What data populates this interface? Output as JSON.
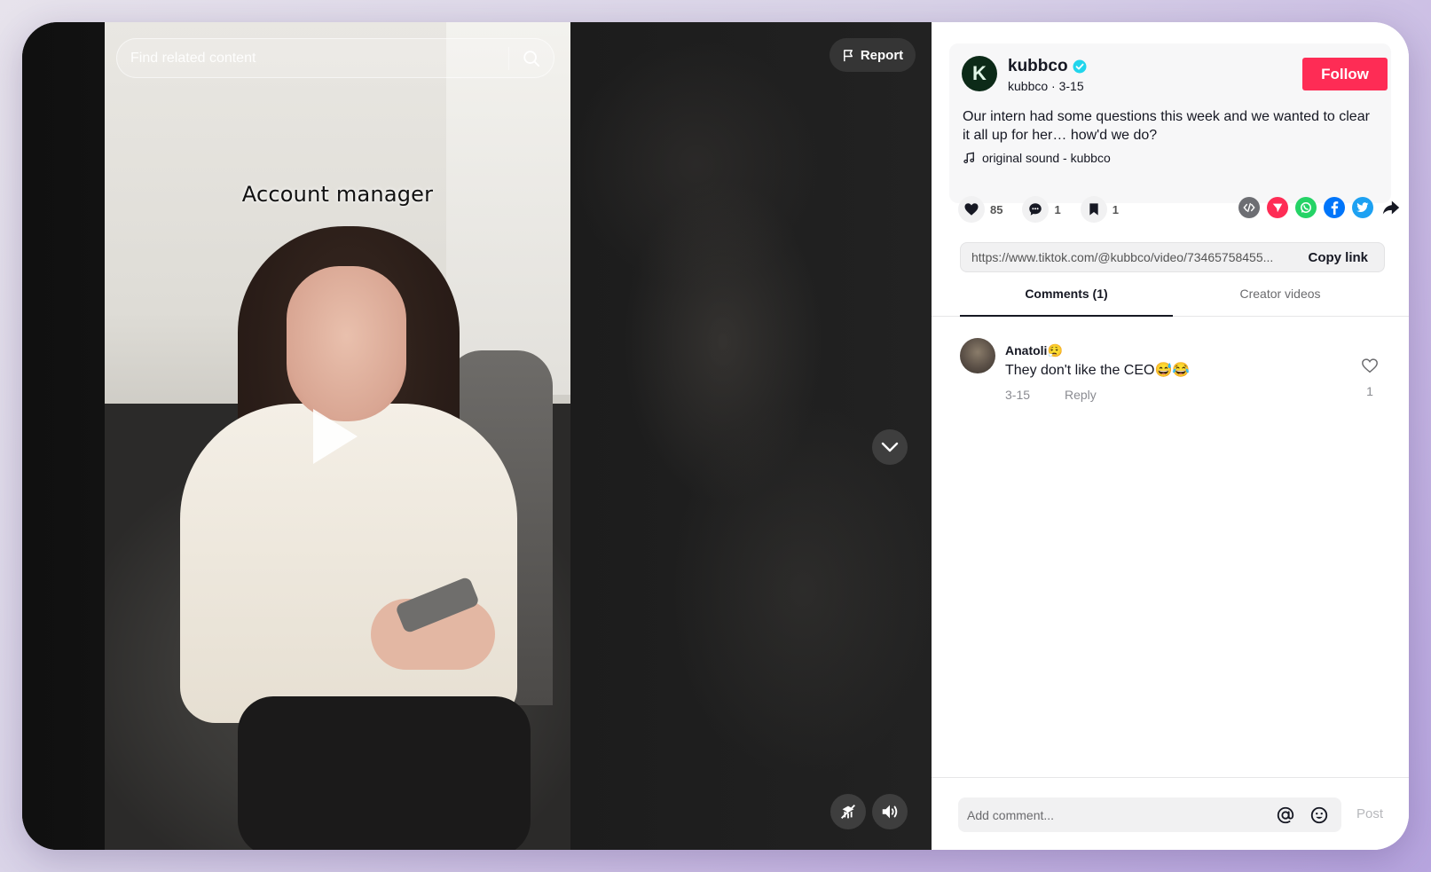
{
  "video": {
    "caption": "Account manager",
    "search_placeholder": "Find related content",
    "report_label": "Report"
  },
  "post": {
    "avatar_letter": "K",
    "author_name": "kubbco",
    "author_handle": "kubbco",
    "date": "3-15",
    "follow_label": "Follow",
    "description": "Our intern had some questions this week and we wanted to clear it all up for her… how'd we do?",
    "music": "original sound - kubbco"
  },
  "actions": {
    "likes": "85",
    "comments": "1",
    "saves": "1"
  },
  "link": {
    "url": "https://www.tiktok.com/@kubbco/video/73465758455...",
    "copy_label": "Copy link"
  },
  "tabs": {
    "comments": "Comments (1)",
    "creator_videos": "Creator videos"
  },
  "comments": [
    {
      "user": "Anatoli😮‍💨",
      "text": "They don't like the CEO😅😂",
      "date": "3-15",
      "reply_label": "Reply",
      "likes": "1"
    }
  ],
  "composer": {
    "placeholder": "Add comment...",
    "post_label": "Post"
  },
  "colors": {
    "follow": "#fe2c55",
    "verified": "#20d5ec",
    "whatsapp": "#25d366",
    "facebook": "#0075fa",
    "twitter": "#1da1f2",
    "repost": "#fe2c55"
  }
}
